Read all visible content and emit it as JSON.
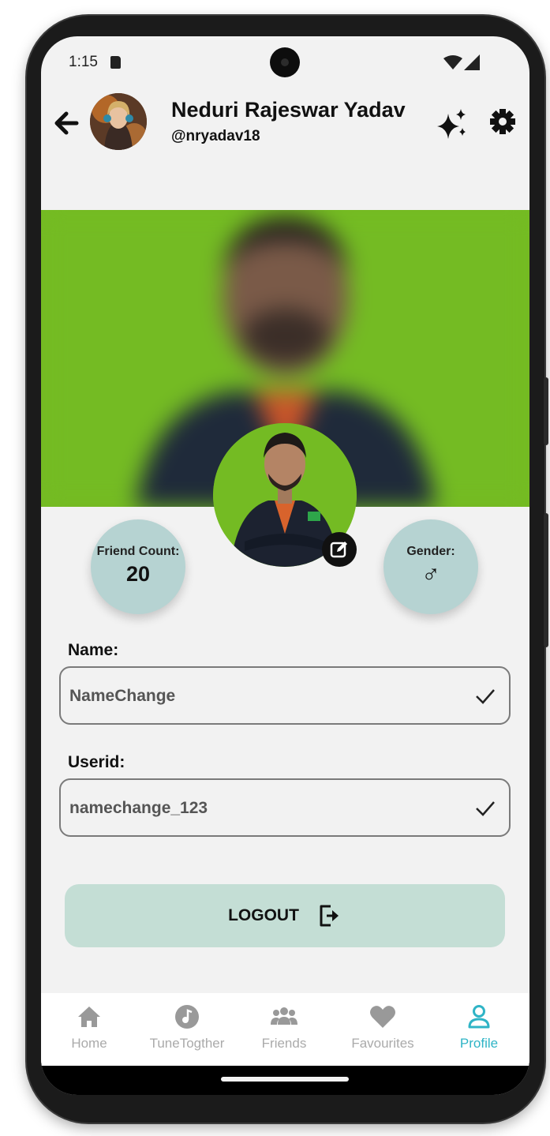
{
  "status_bar": {
    "time": "1:15"
  },
  "header": {
    "name": "Neduri Rajeswar Yadav",
    "handle": "@nryadav18"
  },
  "stats": {
    "friend_count_label": "Friend Count:",
    "friend_count_value": "20",
    "gender_label": "Gender:",
    "gender_symbol": "♂"
  },
  "form": {
    "name_label": "Name:",
    "name_value": "NameChange",
    "userid_label": "Userid:",
    "userid_value": "namechange_123"
  },
  "logout": {
    "label": "LOGOUT"
  },
  "nav": {
    "items": [
      {
        "label": "Home",
        "icon": "home-icon"
      },
      {
        "label": "TuneTogther",
        "icon": "music-disc-icon"
      },
      {
        "label": "Friends",
        "icon": "friends-icon"
      },
      {
        "label": "Favourites",
        "icon": "heart-icon"
      },
      {
        "label": "Profile",
        "icon": "profile-icon"
      }
    ],
    "active_color": "#2fb4c6",
    "inactive_color": "#aaaaaa"
  },
  "colors": {
    "banner_green": "#74bb23",
    "stat_circle": "#b6d3d2",
    "logout_bg": "#c4ded5",
    "screen_bg": "#f2f2f2"
  }
}
